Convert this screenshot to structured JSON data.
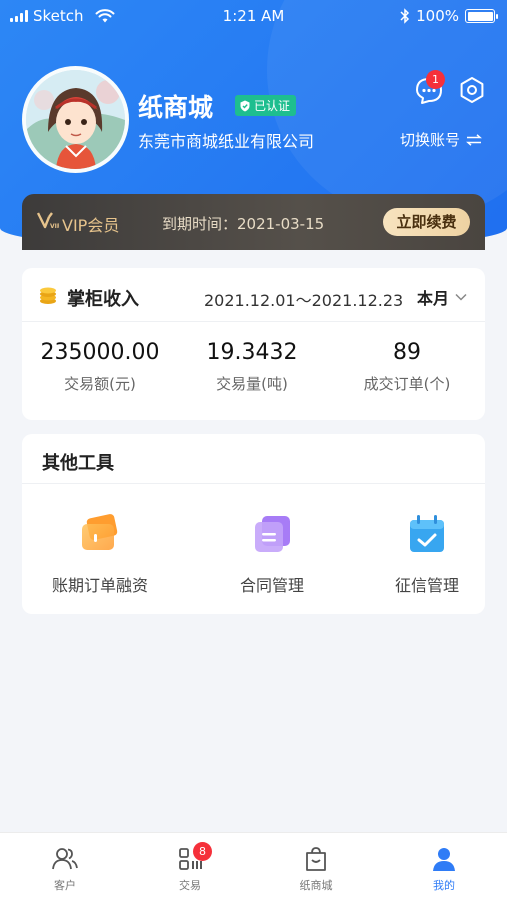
{
  "status_bar": {
    "carrier": "Sketch",
    "time": "1:21 AM",
    "battery": "100%"
  },
  "profile": {
    "name": "纸商城",
    "verified_label": "已认证",
    "company": "东莞市商城纸业有限公司",
    "message_count": "1",
    "switch_account_label": "切换账号"
  },
  "vip": {
    "label": "VIP会员",
    "expire_text": "到期时间：2021-03-15",
    "renew_label": "立即续费"
  },
  "income": {
    "title": "掌柜收入",
    "date_range": "2021.12.01～2021.12.23",
    "period": "本月",
    "stats": [
      {
        "value": "235000.00",
        "label": "交易额(元)"
      },
      {
        "value": "19.3432",
        "label": "交易量(吨)"
      },
      {
        "value": "89",
        "label": "成交订单(个)"
      }
    ]
  },
  "tools": {
    "title": "其他工具",
    "items": [
      {
        "label": "账期订单融资",
        "icon": "card-finance-icon"
      },
      {
        "label": "合同管理",
        "icon": "contract-icon"
      },
      {
        "label": "征信管理",
        "icon": "calendar-check-icon"
      }
    ]
  },
  "tabbar": {
    "items": [
      {
        "label": "客户",
        "icon": "customers-icon"
      },
      {
        "label": "交易",
        "icon": "trade-icon",
        "badge": "8"
      },
      {
        "label": "纸商城",
        "icon": "shopping-bag-icon"
      },
      {
        "label": "我的",
        "icon": "user-icon"
      }
    ],
    "active_color": "#2f7cf6"
  },
  "colors": {
    "brand_blue": "#2d87f5",
    "verified_green": "#1ebe8f",
    "badge_red": "#f5303a",
    "vip_gold": "#e6c38c"
  }
}
